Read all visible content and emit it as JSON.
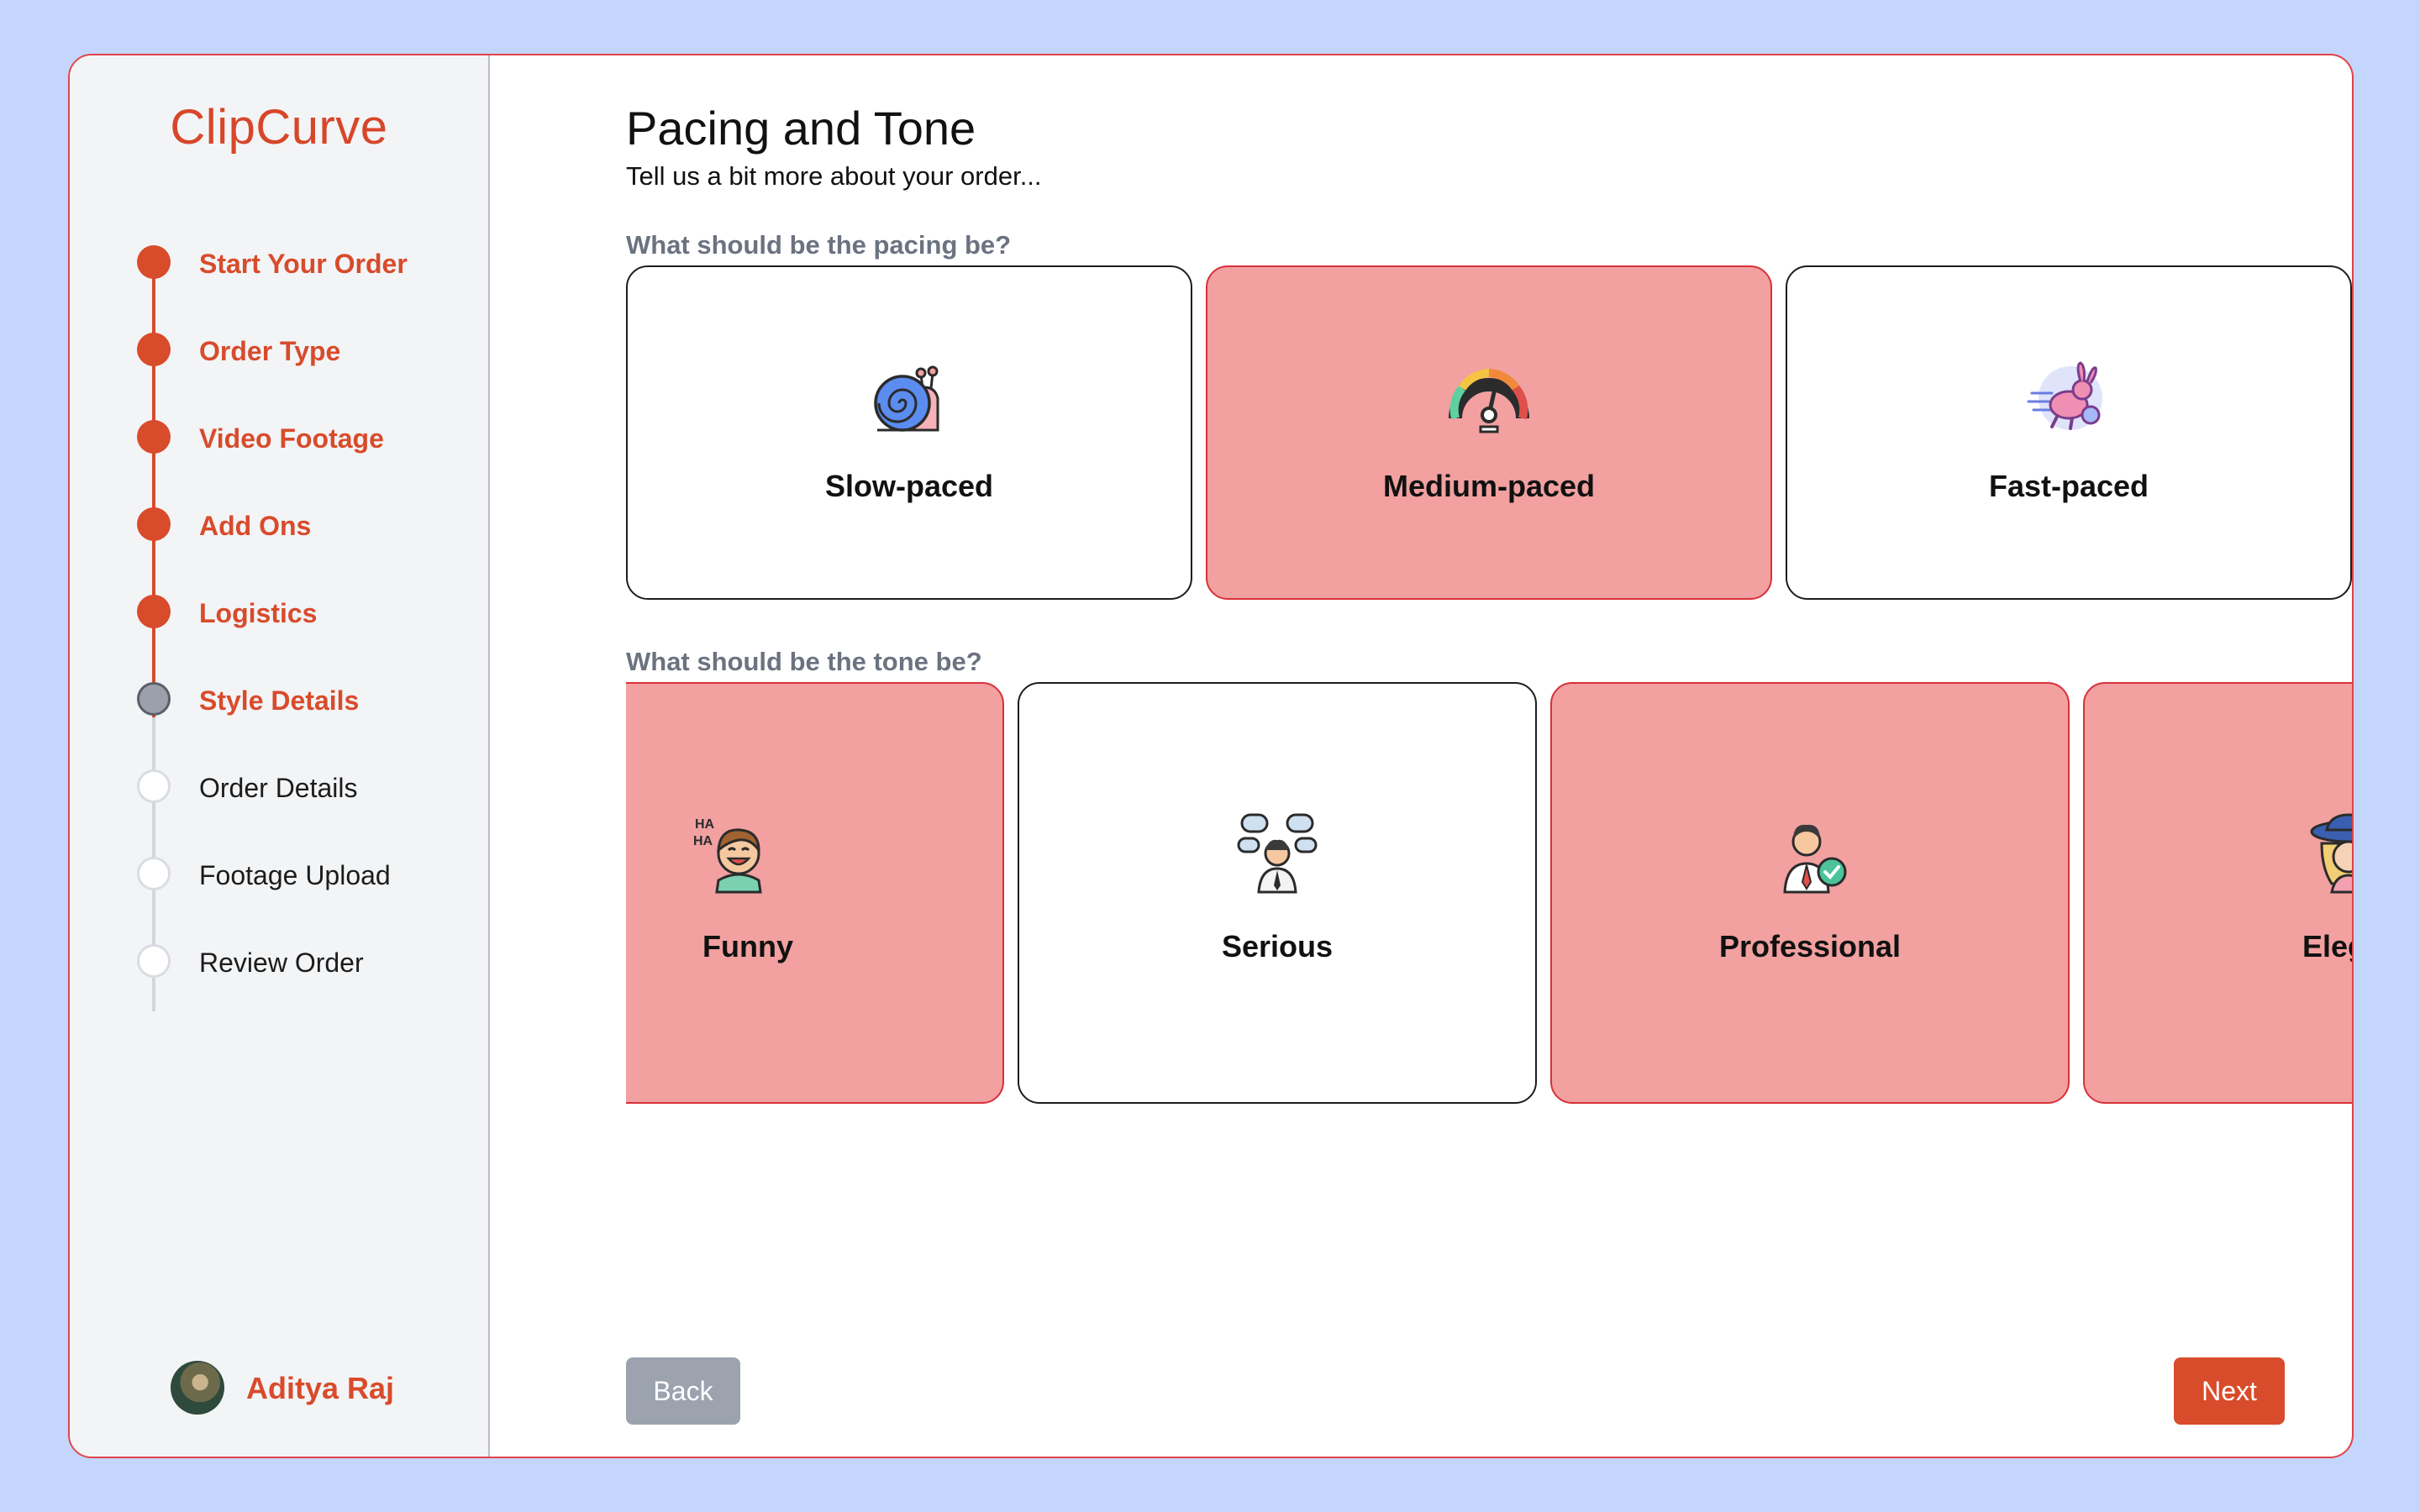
{
  "brand": "ClipCurve",
  "steps": [
    {
      "label": "Start Your Order",
      "status": "complete"
    },
    {
      "label": "Order Type",
      "status": "complete"
    },
    {
      "label": "Video Footage",
      "status": "complete"
    },
    {
      "label": "Add Ons",
      "status": "complete"
    },
    {
      "label": "Logistics",
      "status": "complete"
    },
    {
      "label": "Style Details",
      "status": "current"
    },
    {
      "label": "Order Details",
      "status": "upcoming"
    },
    {
      "label": "Footage Upload",
      "status": "upcoming"
    },
    {
      "label": "Review Order",
      "status": "upcoming"
    }
  ],
  "user": {
    "name": "Aditya Raj"
  },
  "page": {
    "title": "Pacing and Tone",
    "subtitle": "Tell us a bit more about your order..."
  },
  "pacing": {
    "question": "What should be the pacing be?",
    "options": [
      {
        "label": "Slow-paced",
        "icon": "snail-icon",
        "selected": false
      },
      {
        "label": "Medium-paced",
        "icon": "speedometer-icon",
        "selected": true
      },
      {
        "label": "Fast-paced",
        "icon": "rabbit-icon",
        "selected": false
      }
    ]
  },
  "tone": {
    "question": "What should be the tone be?",
    "options": [
      {
        "label": "Funny",
        "icon": "laughing-boy-icon",
        "selected": true
      },
      {
        "label": "Serious",
        "icon": "thinking-person-icon",
        "selected": false
      },
      {
        "label": "Professional",
        "icon": "businessman-icon",
        "selected": true
      },
      {
        "label": "Elega",
        "icon": "elegant-lady-icon",
        "selected": true
      }
    ]
  },
  "buttons": {
    "back": "Back",
    "next": "Next"
  },
  "colors": {
    "accent": "#d84b2b",
    "selected_fill": "#f2a0a0",
    "frame_border": "#e0434a",
    "page_background": "#c5d6fd"
  }
}
